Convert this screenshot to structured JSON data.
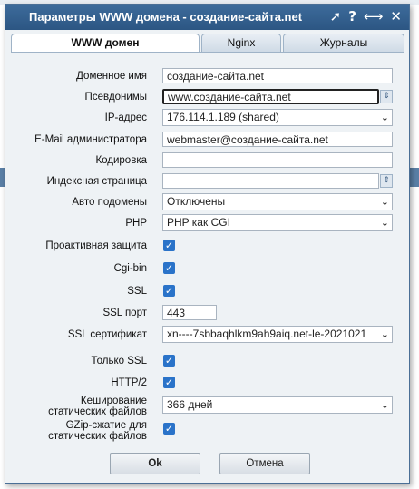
{
  "dialog": {
    "title": "Параметры WWW домена - создание-сайта.net",
    "icons": [
      "pin-icon",
      "help-icon",
      "resize-icon",
      "close-icon"
    ]
  },
  "tabs": [
    {
      "label": "WWW домен",
      "active": true
    },
    {
      "label": "Nginx",
      "active": false
    },
    {
      "label": "Журналы",
      "active": false
    }
  ],
  "form": {
    "domain_name": {
      "label": "Доменное имя",
      "value": "создание-сайта.net"
    },
    "aliases": {
      "label": "Псевдонимы",
      "value": "www.создание-сайта.net"
    },
    "ip": {
      "label": "IP-адрес",
      "value": "176.114.1.189 (shared)"
    },
    "email": {
      "label": "E-Mail администратора",
      "value": "webmaster@создание-сайта.net"
    },
    "encoding": {
      "label": "Кодировка",
      "value": ""
    },
    "index_page": {
      "label": "Индексная страница",
      "value": ""
    },
    "auto_subdomains": {
      "label": "Авто подомены",
      "value": "Отключены"
    },
    "php": {
      "label": "PHP",
      "value": "PHP как CGI"
    },
    "proactive": {
      "label": "Проактивная защита",
      "checked": true
    },
    "cgi_bin": {
      "label": "Cgi-bin",
      "checked": true
    },
    "ssl": {
      "label": "SSL",
      "checked": true
    },
    "ssl_port": {
      "label": "SSL порт",
      "value": "443"
    },
    "ssl_cert": {
      "label": "SSL сертификат",
      "value": "xn----7sbbaqhlkm9ah9aiq.net-le-2021021"
    },
    "ssl_only": {
      "label": "Только SSL",
      "checked": true
    },
    "http2": {
      "label": "HTTP/2",
      "checked": true
    },
    "static_cache": {
      "label_line1": "Кеширование",
      "label_line2": "статических файлов",
      "value": "366 дней"
    },
    "gzip": {
      "label_line1": "GZip-сжатие для",
      "label_line2": "статических файлов",
      "checked": true
    }
  },
  "buttons": {
    "ok": "Ok",
    "cancel": "Отмена"
  },
  "colors": {
    "titlebar": "#2c5683",
    "checkbox": "#2a73c9",
    "panel": "#eef2f5"
  }
}
